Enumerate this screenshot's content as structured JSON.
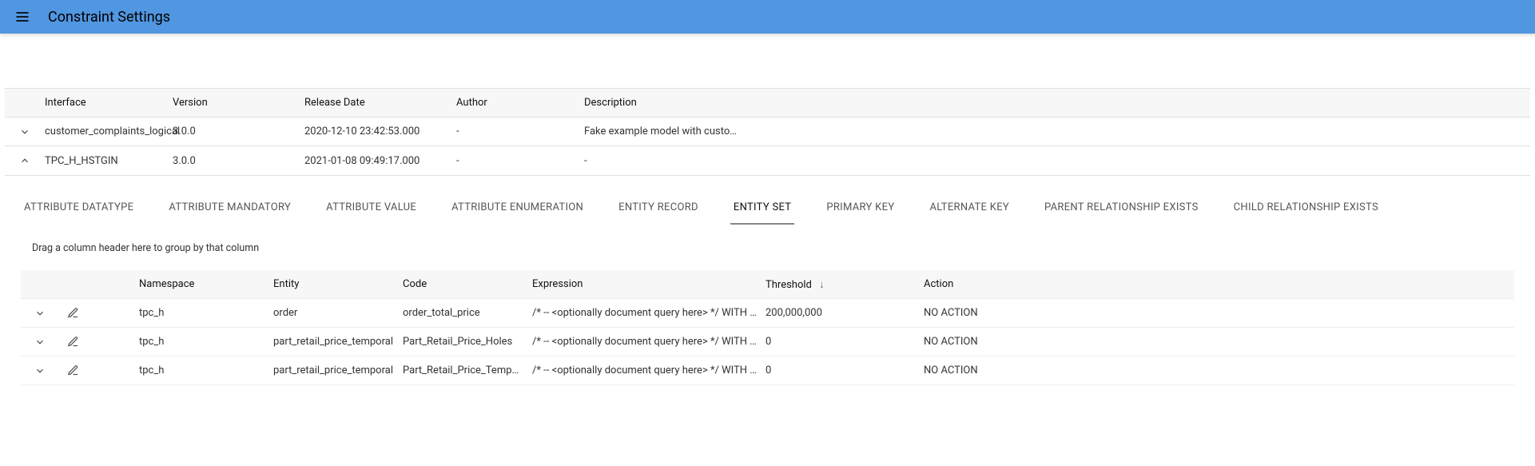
{
  "header": {
    "title": "Constraint Settings"
  },
  "outer_grid": {
    "columns": {
      "interface": "Interface",
      "version": "Version",
      "release_date": "Release Date",
      "author": "Author",
      "description": "Description"
    },
    "rows": [
      {
        "expanded": false,
        "interface": "customer_complaints_logical",
        "version": "3.0.0",
        "release_date": "2020-12-10 23:42:53.000",
        "author": "-",
        "description": "Fake example model with custo…"
      },
      {
        "expanded": true,
        "interface": "TPC_H_HSTGIN",
        "version": "3.0.0",
        "release_date": "2021-01-08 09:49:17.000",
        "author": "-",
        "description": "-"
      }
    ]
  },
  "tabs": [
    {
      "label": "ATTRIBUTE DATATYPE",
      "active": false
    },
    {
      "label": "ATTRIBUTE MANDATORY",
      "active": false
    },
    {
      "label": "ATTRIBUTE VALUE",
      "active": false
    },
    {
      "label": "ATTRIBUTE ENUMERATION",
      "active": false
    },
    {
      "label": "ENTITY RECORD",
      "active": false
    },
    {
      "label": "ENTITY SET",
      "active": true
    },
    {
      "label": "PRIMARY KEY",
      "active": false
    },
    {
      "label": "ALTERNATE KEY",
      "active": false
    },
    {
      "label": "PARENT RELATIONSHIP EXISTS",
      "active": false
    },
    {
      "label": "CHILD RELATIONSHIP EXISTS",
      "active": false
    }
  ],
  "group_hint": "Drag a column header here to group by that column",
  "inner_grid": {
    "columns": {
      "namespace": "Namespace",
      "entity": "Entity",
      "code": "Code",
      "expression": "Expression",
      "threshold": "Threshold",
      "action": "Action"
    },
    "sort": {
      "column": "threshold",
      "direction": "desc"
    },
    "rows": [
      {
        "namespace": "tpc_h",
        "entity": "order",
        "code": "order_total_price",
        "expression": "/* -- <optionally document query here> */ WITH QRY AS  ( S…",
        "threshold": "200,000,000",
        "action": "NO ACTION"
      },
      {
        "namespace": "tpc_h",
        "entity": "part_retail_price_temporal",
        "code": "Part_Retail_Price_Holes",
        "expression": "/* -- <optionally document query here> */ WITH FLT AS ( SE…",
        "threshold": "0",
        "action": "NO ACTION"
      },
      {
        "namespace": "tpc_h",
        "entity": "part_retail_price_temporal",
        "code": "Part_Retail_Price_Temporal_O…",
        "expression": "/* -- <optionally document query here> */ WITH QRY AS  ( S…",
        "threshold": "0",
        "action": "NO ACTION"
      }
    ]
  }
}
